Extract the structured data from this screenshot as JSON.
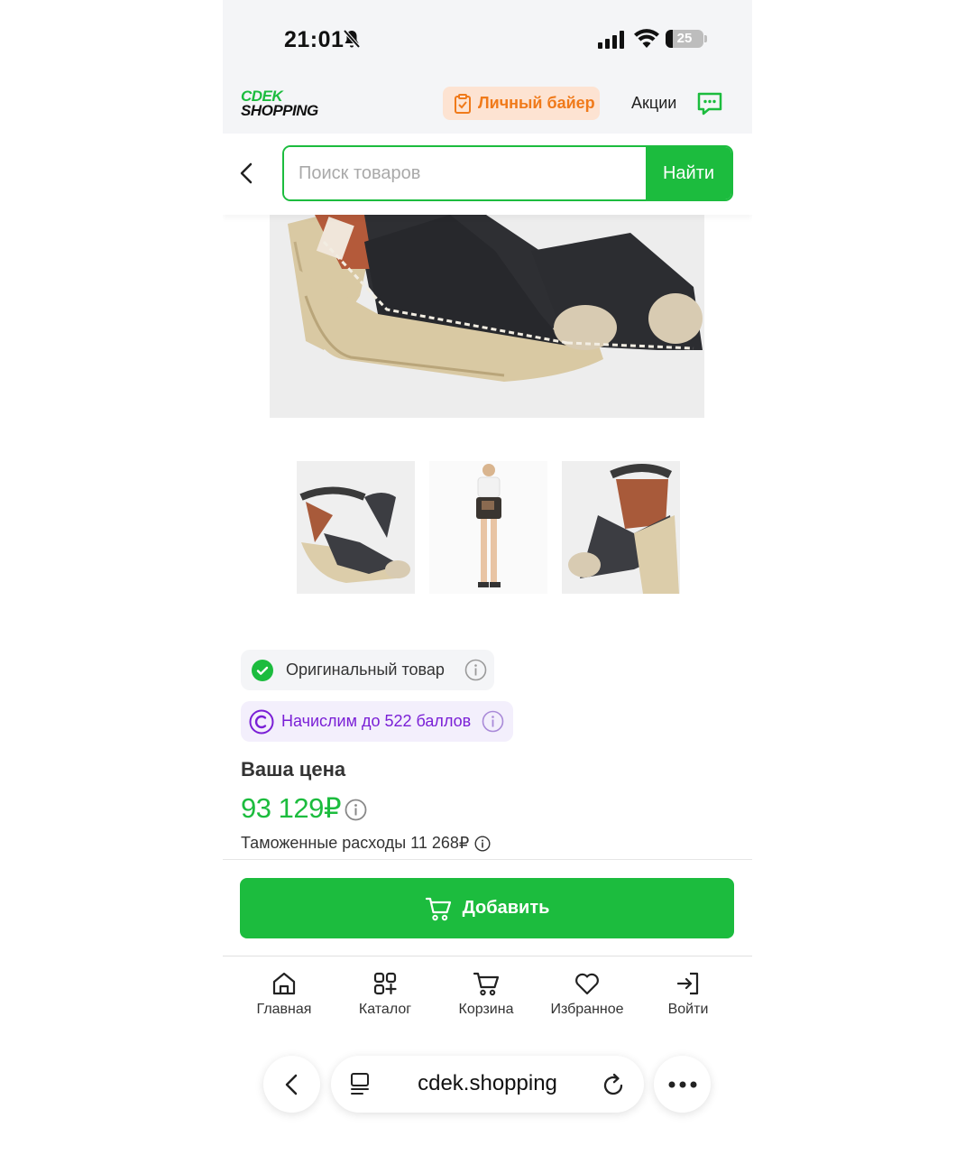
{
  "status_bar": {
    "time": "21:01",
    "battery": "25",
    "bell_icon": "bell-slash-icon",
    "signal_icon": "cellular-signal-icon",
    "wifi_icon": "wifi-icon"
  },
  "header": {
    "logo_line1": "CDEK",
    "logo_line2": "SHOPPING",
    "personal_buyer_label": "Личный байер",
    "promotions_label": "Акции",
    "chat_icon": "chat-icon"
  },
  "search": {
    "placeholder": "Поиск товаров",
    "value": "",
    "button_label": "Найти"
  },
  "gallery": {
    "main_image": "espadrille-wedge-shoes-photo",
    "thumbnails": [
      "shoes-side-view",
      "model-wearing-outfit",
      "shoe-back-view"
    ]
  },
  "badges": {
    "original_label": "Оригинальный товар",
    "bonus_label": "Начислим до 522 баллов"
  },
  "price": {
    "label": "Ваша цена",
    "value": "93 129₽",
    "customs": "Таможенные расходы 11 268₽"
  },
  "add_button_label": "Добавить",
  "bottom_nav": {
    "items": [
      {
        "label": "Главная",
        "icon": "home-icon"
      },
      {
        "label": "Каталог",
        "icon": "catalog-icon"
      },
      {
        "label": "Корзина",
        "icon": "cart-icon"
      },
      {
        "label": "Избранное",
        "icon": "heart-icon"
      },
      {
        "label": "Войти",
        "icon": "login-icon"
      }
    ]
  },
  "browser": {
    "url": "cdek.shopping"
  },
  "colors": {
    "brand_green": "#1cbc3e",
    "buyer_orange": "#f07a1a",
    "buyer_bg": "#fde3d2",
    "bonus_purple": "#7a1fd6",
    "bonus_bg": "#f3effc"
  }
}
